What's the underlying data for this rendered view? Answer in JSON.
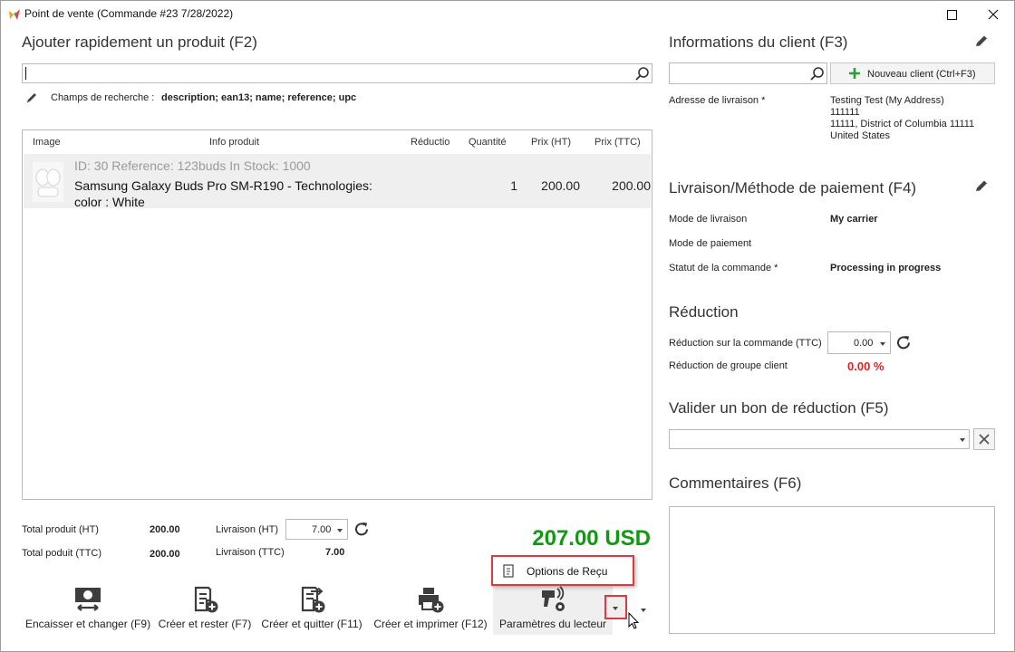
{
  "window": {
    "title": "Point de vente (Commande #23 7/28/2022)"
  },
  "product_search": {
    "heading": "Ajouter rapidement un produit (F2)",
    "value": "",
    "search_fields_label": "Champs de recherche :",
    "search_fields_value": "description; ean13; name; reference; upc"
  },
  "grid": {
    "columns": [
      "Image",
      "Info produit",
      "Réductio",
      "Quantité",
      "Prix (HT)",
      "Prix (TTC)"
    ],
    "rows": [
      {
        "meta": "ID: 30 Reference: 123buds In Stock: 1000",
        "name_line1": "Samsung Galaxy Buds Pro SM-R190  - Technologies:",
        "name_line2": "color : White",
        "reduction": "",
        "quantity": "1",
        "price_ht": "200.00",
        "price_ttc": "200.00"
      }
    ]
  },
  "totals": {
    "total_ht_label": "Total produit (HT)",
    "total_ht_value": "200.00",
    "total_ttc_label": "Total poduit (TTC)",
    "total_ttc_value": "200.00",
    "shipping_ht_label": "Livraison (HT)",
    "shipping_ht_value": "7.00",
    "shipping_ttc_label": "Livraison (TTC)",
    "shipping_ttc_value": "7.00",
    "grand_total": "207.00 USD"
  },
  "toolbar": {
    "cash_change": "Encaisser et changer (F9)",
    "create_stay": "Créer et rester (F7)",
    "create_quit": "Créer et quitter (F11)",
    "create_print": "Créer et imprimer (F12)",
    "reader_params": "Paramètres du lecteur"
  },
  "popup": {
    "receipt_options": "Options de Reçu"
  },
  "client": {
    "heading": "Informations du client (F3)",
    "search_value": "",
    "new_client_label": "Nouveau client (Ctrl+F3)",
    "address_label": "Adresse de livraison *",
    "address_lines": [
      "Testing Test (My Address)",
      "111111",
      "11111, District of Columbia 11111",
      "United States"
    ]
  },
  "shipping_payment": {
    "heading": "Livraison/Méthode de paiement (F4)",
    "carrier_label": "Mode de livraison",
    "carrier_value": "My carrier",
    "payment_label": "Mode de paiement",
    "payment_value": "",
    "status_label": "Statut de la commande *",
    "status_value": "Processing in progress"
  },
  "reduction": {
    "heading": "Réduction",
    "order_label": "Réduction sur la commande (TTC)",
    "order_value": "0.00",
    "group_label": "Réduction de groupe client",
    "group_value": "0.00 %"
  },
  "voucher": {
    "heading": "Valider un bon de réduction (F5)",
    "value": ""
  },
  "comments": {
    "heading": "Commentaires (F6)",
    "value": ""
  },
  "colors": {
    "accent_green": "#109a10",
    "alert_red": "#e02020",
    "highlight_border": "#e0383e"
  }
}
